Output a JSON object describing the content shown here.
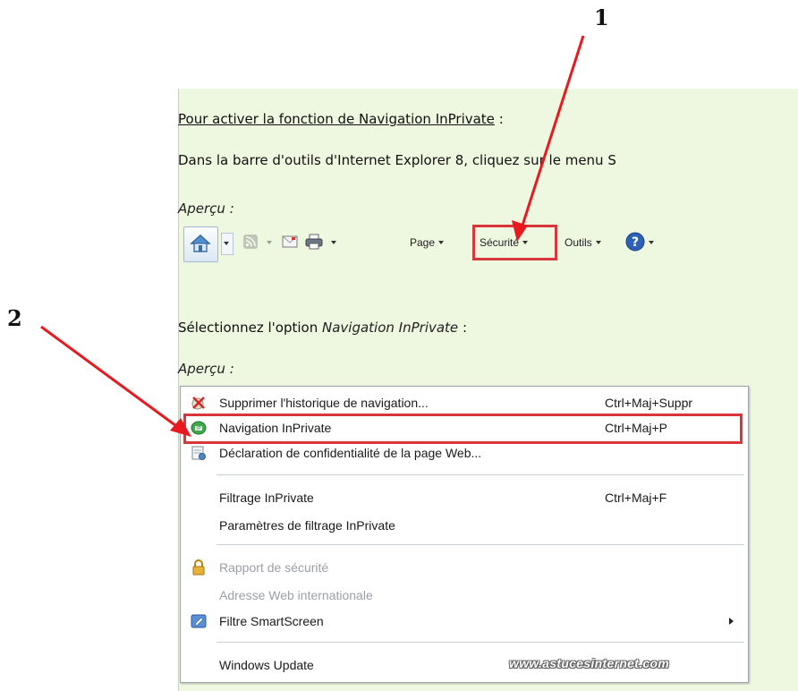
{
  "callouts": {
    "one": "1",
    "two": "2"
  },
  "instructions": {
    "heading": "Pour activer la fonction de Navigation InPrivate",
    "heading_suffix": " :",
    "step1": "Dans la barre d'outils d'Internet Explorer 8, cliquez sur le menu S",
    "preview_label_1": "Aperçu :",
    "step2_prefix": "Sélectionnez l'option ",
    "step2_option": "Navigation InPrivate",
    "step2_suffix": " :",
    "preview_label_2": "Aperçu :"
  },
  "toolbar": {
    "page_label": "Page",
    "security_label": "Sécurité",
    "tools_label": "Outils",
    "icons": [
      "home-icon",
      "rss-feed-icon",
      "mail-icon",
      "print-icon",
      "help-icon"
    ]
  },
  "menu": {
    "items": [
      {
        "label": "Supprimer l'historique de navigation...",
        "shortcut": "Ctrl+Maj+Suppr",
        "icon": "delete-history-icon"
      },
      {
        "label": "Navigation InPrivate",
        "shortcut": "Ctrl+Maj+P",
        "icon": "inprivate-icon"
      },
      {
        "label": "Déclaration de confidentialité de la page Web...",
        "shortcut": "",
        "icon": "privacy-report-icon"
      },
      {
        "label": "Filtrage InPrivate",
        "shortcut": "Ctrl+Maj+F"
      },
      {
        "label": "Paramètres de filtrage InPrivate",
        "shortcut": ""
      },
      {
        "label": "Rapport de sécurité",
        "shortcut": "",
        "icon": "lock-icon",
        "disabled": true
      },
      {
        "label": "Adresse Web internationale",
        "shortcut": "",
        "disabled": true
      },
      {
        "label": "Filtre SmartScreen",
        "shortcut": "",
        "icon": "smartscreen-icon",
        "submenu": true
      },
      {
        "label": "Windows Update",
        "shortcut": ""
      }
    ],
    "watermark": "www.astucesinternet.com"
  },
  "colors": {
    "panel_bg": "#eef7e0",
    "highlight_red": "#d9363c",
    "arrow_red": "#e8191f"
  }
}
